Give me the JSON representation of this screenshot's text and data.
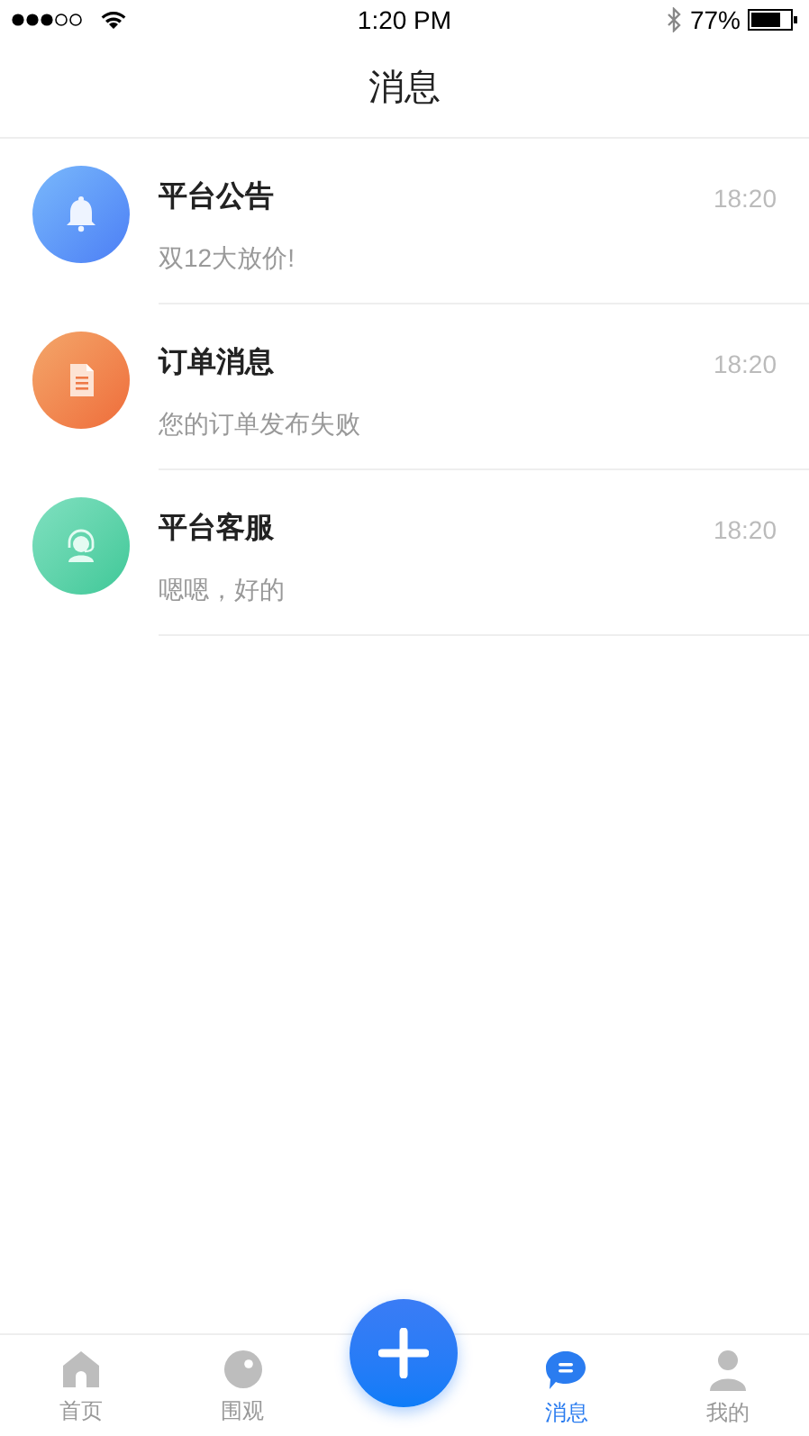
{
  "status_bar": {
    "time": "1:20 PM",
    "battery": "77%"
  },
  "header": {
    "title": "消息"
  },
  "messages": [
    {
      "kind": "notice",
      "title": "平台公告",
      "preview": "双12大放价!",
      "time": "18:20"
    },
    {
      "kind": "order",
      "title": "订单消息",
      "preview": "您的订单发布失败",
      "time": "18:20"
    },
    {
      "kind": "service",
      "title": "平台客服",
      "preview": "嗯嗯，好的",
      "time": "18:20"
    }
  ],
  "tab_bar": [
    {
      "kind": "home",
      "label": "首页",
      "selected": false
    },
    {
      "kind": "explore",
      "label": "围观",
      "selected": false
    },
    {
      "kind": "add"
    },
    {
      "kind": "messages",
      "label": "消息",
      "selected": true
    },
    {
      "kind": "profile",
      "label": "我的",
      "selected": false
    }
  ]
}
